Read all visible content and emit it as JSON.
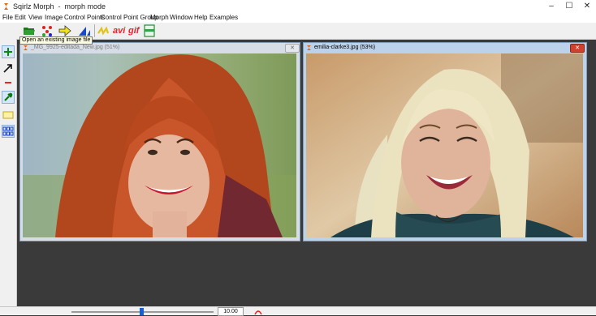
{
  "window": {
    "title": "Sqirlz Morph",
    "mode": "morph mode",
    "minimize_glyph": "–",
    "maximize_glyph": "☐",
    "close_glyph": "✕"
  },
  "menu": [
    "File",
    "Edit",
    "View",
    "Image",
    "Control Points",
    "Control Point Group",
    "Morph",
    "Window",
    "Help",
    "Examples"
  ],
  "toolbar": {
    "items": [
      "open-folder-icon",
      "control-points-icon",
      "forward-arrow-icon",
      "triangle-mesh-icon",
      "morph-sequence-icon",
      "avi-export",
      "gif-export",
      "panel-icon"
    ],
    "avi_label": "avi",
    "gif_label": "gif",
    "tooltip": "Open an existing image file"
  },
  "left_tools": [
    "add-point-icon",
    "arrow-icon",
    "remove-point-icon",
    "pin-icon",
    "rectangle-icon",
    "grid-icon"
  ],
  "images": [
    {
      "title": "_MG_9925-editada_New.jpg  (51%)",
      "active": false
    },
    {
      "title": "emilia-clarke3.jpg  (53%)",
      "active": true
    }
  ],
  "status": {
    "value": "10.00"
  },
  "colors": {
    "accent": "#e9232a",
    "active_title": "#bcd1ea",
    "workspace": "#3a3a3a"
  }
}
